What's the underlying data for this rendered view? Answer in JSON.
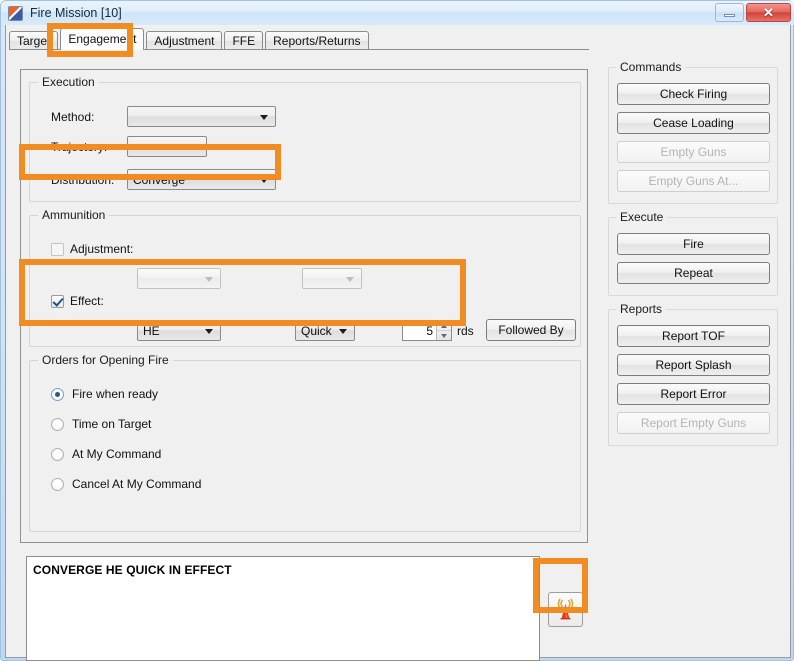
{
  "window": {
    "title": "Fire Mission [10]",
    "app_icon": "app-icon",
    "minimize_label": "",
    "close_label": "✕"
  },
  "tabs": [
    {
      "label": "Target",
      "active": false
    },
    {
      "label": "Engagement",
      "active": true
    },
    {
      "label": "Adjustment",
      "active": false
    },
    {
      "label": "FFE",
      "active": false
    },
    {
      "label": "Reports/Returns",
      "active": false
    }
  ],
  "execution": {
    "group_title": "Execution",
    "method": {
      "label": "Method:",
      "value": ""
    },
    "trajectory": {
      "label": "Trajectory:",
      "value": ""
    },
    "distribution": {
      "label": "Distribution:",
      "value": "Converge"
    }
  },
  "ammunition": {
    "group_title": "Ammunition",
    "adjustment": {
      "label": "Adjustment:",
      "checked": false,
      "shell": "",
      "fuze": ""
    },
    "effect": {
      "label": "Effect:",
      "checked": true,
      "shell": "HE",
      "fuze": "Quick",
      "rounds": "5",
      "rounds_unit": "rds",
      "followed_by_label": "Followed By"
    }
  },
  "orders": {
    "group_title": "Orders for Opening Fire",
    "options": [
      {
        "label": "Fire when ready",
        "selected": true
      },
      {
        "label": "Time on Target",
        "selected": false
      },
      {
        "label": "At My Command",
        "selected": false
      },
      {
        "label": "Cancel At My Command",
        "selected": false
      }
    ]
  },
  "commands": {
    "group_title": "Commands",
    "buttons": [
      {
        "label": "Check Firing",
        "enabled": true
      },
      {
        "label": "Cease Loading",
        "enabled": true
      },
      {
        "label": "Empty Guns",
        "enabled": false
      },
      {
        "label": "Empty Guns At...",
        "enabled": false
      }
    ]
  },
  "execute": {
    "group_title": "Execute",
    "buttons": [
      {
        "label": "Fire",
        "enabled": true
      },
      {
        "label": "Repeat",
        "enabled": true
      }
    ]
  },
  "reports": {
    "group_title": "Reports",
    "buttons": [
      {
        "label": "Report TOF",
        "enabled": true
      },
      {
        "label": "Report Splash",
        "enabled": true
      },
      {
        "label": "Report Error",
        "enabled": true
      },
      {
        "label": "Report Empty Guns",
        "enabled": false
      }
    ]
  },
  "message": {
    "text": "CONVERGE HE QUICK IN EFFECT"
  },
  "transmit": {
    "icon": "radio-antenna-icon"
  },
  "annotations": {
    "highlight_color": "#f08c22",
    "targets": [
      "tab-engagement",
      "distribution-row",
      "effect-row",
      "transmit-button"
    ]
  }
}
